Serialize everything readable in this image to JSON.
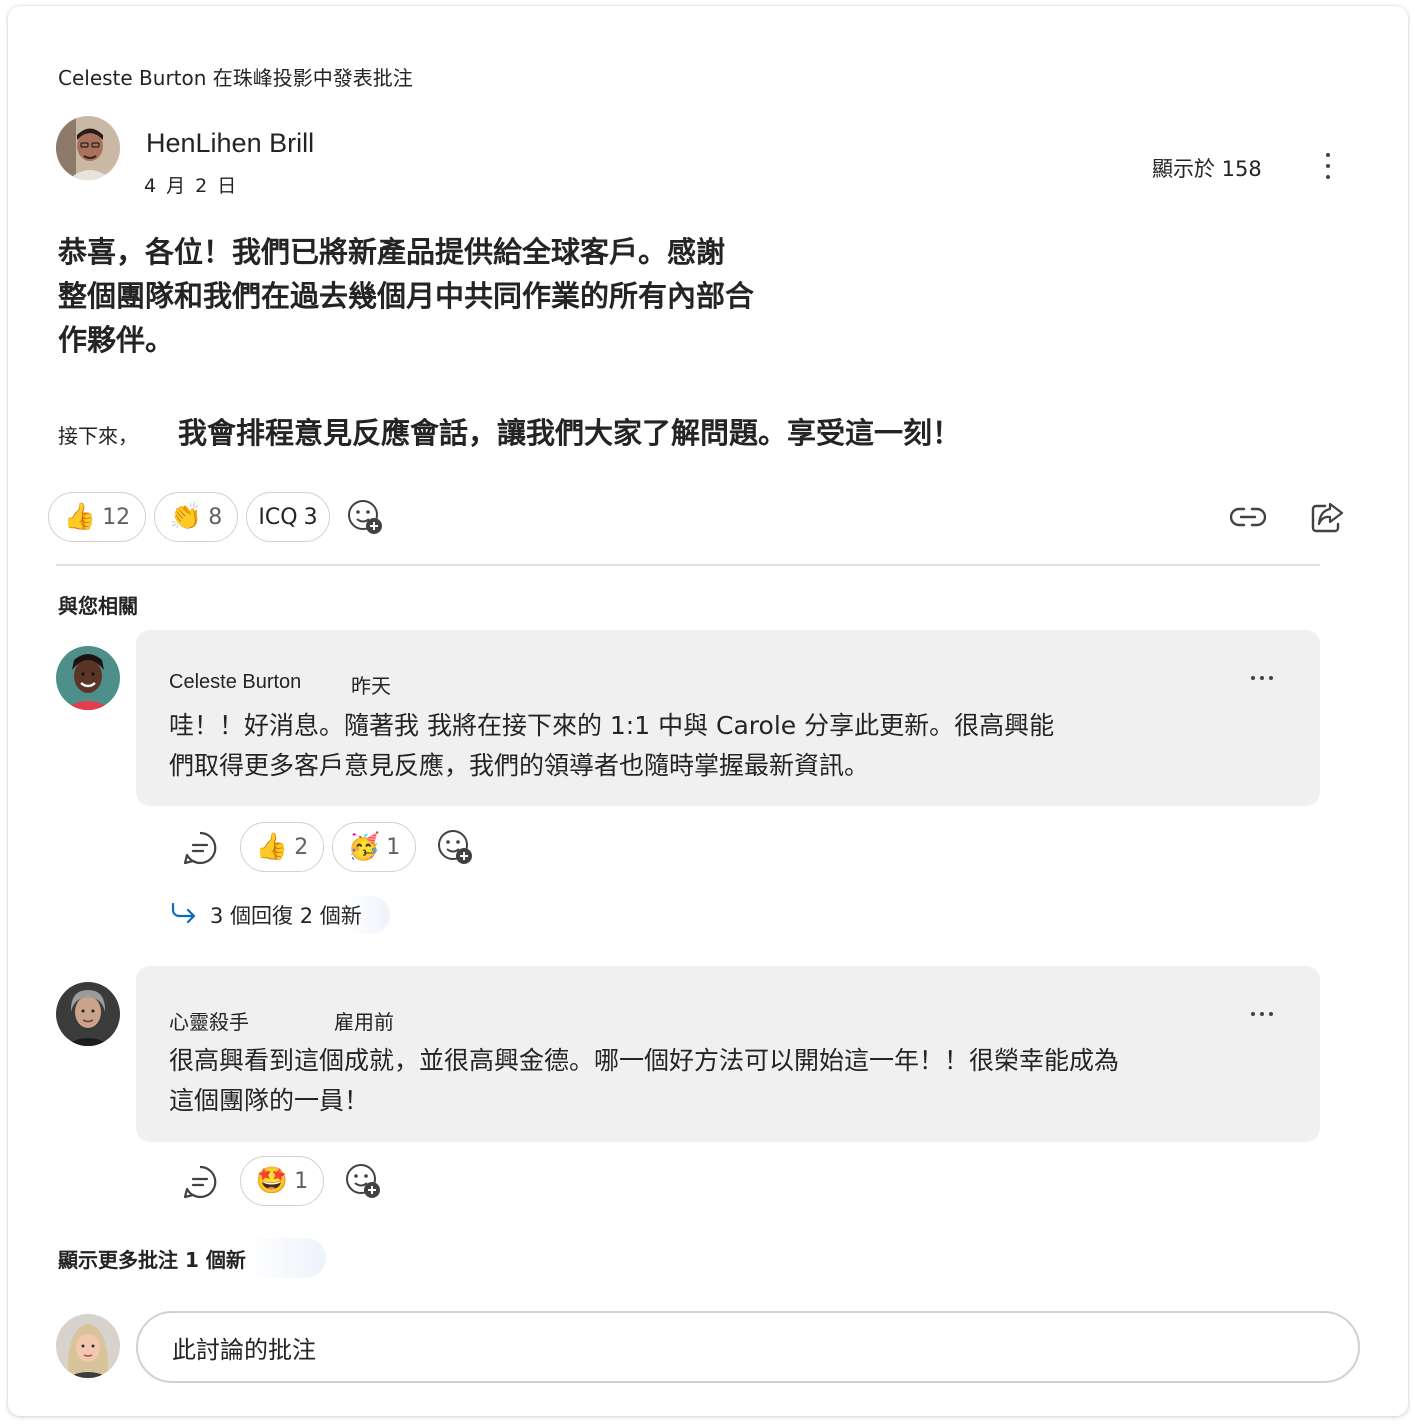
{
  "context_line": "Celeste Burton 在珠峰投影中發表批注",
  "post": {
    "author": "HenLihen Brill",
    "date": "4 月 2 日",
    "views": "顯示於 158",
    "body_lines": [
      "恭喜，各位！我們已將新產品提供給全球客戶。感謝",
      "整個團隊和我們在過去幾個月中共同作業的所有內部合",
      "作夥伴。"
    ],
    "next_prefix": "接下來，",
    "next_text": "我會排程意見反應會話，讓我們大家了解問題。享受這一刻！",
    "reactions": [
      {
        "emoji": "👍",
        "count": "12",
        "name": "like"
      },
      {
        "emoji": "👏",
        "count": "8",
        "name": "clap"
      },
      {
        "emoji": "ICQ",
        "count": "3",
        "name": "icq"
      }
    ]
  },
  "section_label": "與您相關",
  "comments": [
    {
      "author": "Celeste Burton",
      "time": "昨天",
      "lines": [
        "哇！！好消息。隨著我    我將在接下來的 1:1 中與 Carole 分享此更新。很高興能",
        "們取得更多客戶意見反應，我們的領導者也隨時掌握最新資訊。"
      ],
      "reactions": [
        {
          "emoji": "👍",
          "count": "2"
        },
        {
          "emoji": "🥳",
          "count": "1"
        }
      ],
      "replies": "3 個回復 2 個新"
    },
    {
      "author": "心靈殺手",
      "time": "雇用前",
      "lines": [
        "很高興看到這個成就，並很高興金德。哪一個好方法可以開始這一年！！很榮幸能成為",
        "這個團隊的一員！"
      ],
      "reactions": [
        {
          "emoji": "🤩",
          "count": "1"
        }
      ]
    }
  ],
  "show_more": "顯示更多批注 1 個新",
  "composer": {
    "placeholder": "此討論的批注"
  },
  "icons": [
    "more-vertical-icon",
    "add-reaction-icon",
    "link-icon",
    "share-icon",
    "reply-comment-icon",
    "reply-arrow-icon",
    "more-horizontal-icon"
  ],
  "colors": {
    "accent": "#0f6cbd",
    "bubble": "#f0f0f0",
    "border": "#d1d1d1"
  }
}
